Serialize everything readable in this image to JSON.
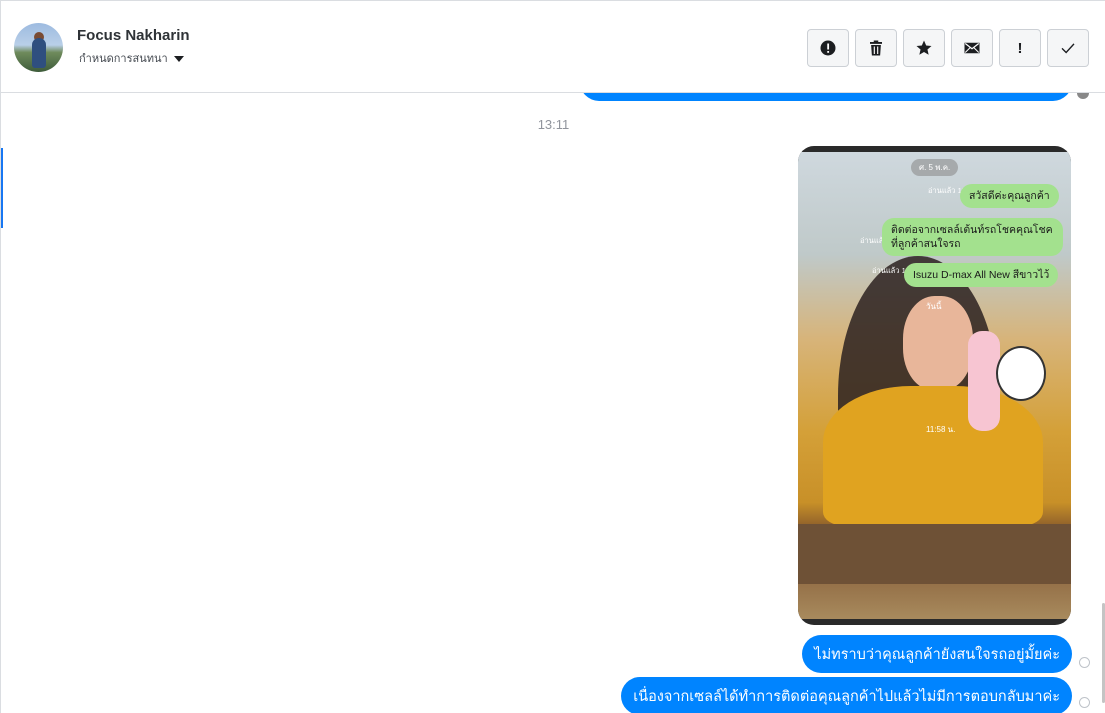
{
  "header": {
    "contact_name": "Focus Nakharin",
    "subtitle": "กำหนดการสนทนา",
    "actions": [
      {
        "name": "report-spam",
        "icon": "alert-circle-icon"
      },
      {
        "name": "delete",
        "icon": "trash-icon"
      },
      {
        "name": "star",
        "icon": "star-icon"
      },
      {
        "name": "mark-unread",
        "icon": "envelope-icon"
      },
      {
        "name": "important",
        "icon": "exclamation-icon",
        "label": "!"
      },
      {
        "name": "done",
        "icon": "check-icon"
      }
    ]
  },
  "chat": {
    "timestamp": "13:11",
    "photo": {
      "date_pill": "ศ. 5 พ.ค.",
      "bubbles": [
        "สวัสดีค่ะคุณลูกค้า",
        "ติดต่อจากเซลล์เต้นท์รถโชคคุณโชค ที่ลูกค้าสนใจรถ",
        "Isuzu D-max All New สีขาวไว้"
      ],
      "read_labels": [
        "อ่านแล้ว 10:29 น.",
        "อ่านแล้ว 10:30 น.",
        "อ่านแล้ว 10:31 น."
      ],
      "today_label": "วันนี้",
      "time_label": "11:58 น."
    },
    "messages": [
      "ไม่ทราบว่าคุณลูกค้ายังสนใจรถอยู่มั้ยค่ะ",
      "เนื่องจากเซลล์ได้ทำการติดต่อคุณลูกค้าไปแล้วไม่มีการตอบกลับมาค่ะ"
    ]
  },
  "colors": {
    "bubble_blue": "#0084ff",
    "line_green": "#a3e18e",
    "accent_blue": "#1877f2"
  }
}
